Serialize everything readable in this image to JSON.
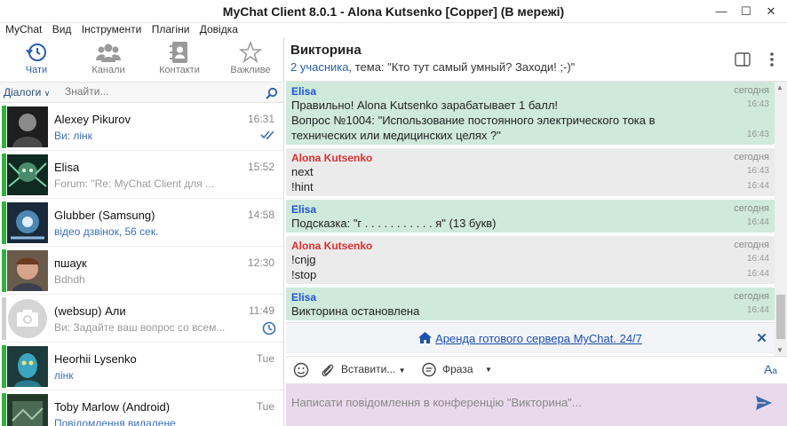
{
  "window": {
    "title": "MyChat Client 8.0.1 - Alona Kutsenko [Copper] (В мережі)"
  },
  "menu": [
    "MyChat",
    "Вид",
    "Інструменти",
    "Плагіни",
    "Довідка"
  ],
  "nav": [
    {
      "label": "Чати",
      "icon": "history-clock-icon",
      "active": true
    },
    {
      "label": "Канали",
      "icon": "group-icon",
      "active": false
    },
    {
      "label": "Контакти",
      "icon": "address-book-icon",
      "active": false
    },
    {
      "label": "Важливе",
      "icon": "star-icon",
      "active": false
    }
  ],
  "filter": {
    "dropdown": "Діалоги",
    "search_placeholder": "Знайти..."
  },
  "contacts": [
    {
      "name": "Alexey Pikurov",
      "sub": "Ви: лінк",
      "time": "16:31",
      "status": "online",
      "sub_style": "blue",
      "mark": "double-check-icon"
    },
    {
      "name": "Elisa",
      "sub": "Forum: \"Re: MyChat Client для ...",
      "time": "15:52",
      "status": "online",
      "sub_style": "gray",
      "mark": ""
    },
    {
      "name": "Glubber (Samsung)",
      "sub": "відео дзвінок, 56 сек.",
      "time": "14:58",
      "status": "online",
      "sub_style": "blue",
      "mark": ""
    },
    {
      "name": "пшаук",
      "sub": "Bdhdh",
      "time": "12:30",
      "status": "online",
      "sub_style": "gray",
      "mark": ""
    },
    {
      "name": "(websup) Али",
      "sub": "Ви: Задайте ваш вопрос со всем...",
      "time": "11:49",
      "status": "offline",
      "sub_style": "gray",
      "mark": "clock-icon"
    },
    {
      "name": "Heorhii Lysenko",
      "sub": "лінк",
      "time": "Tue",
      "status": "online",
      "sub_style": "blue",
      "mark": ""
    },
    {
      "name": "Toby Marlow (Android)",
      "sub": "Повідомлення видалене",
      "time": "Tue",
      "status": "online",
      "sub_style": "blue",
      "mark": ""
    }
  ],
  "chat": {
    "title": "Викторина",
    "participants": "2 учасника",
    "topic": ", тема: \"Кто тут самый умный? Заходи! ;-)\""
  },
  "messages": [
    {
      "author": "Elisa",
      "color": "blue",
      "bg": "green",
      "date": "сегодня",
      "lines": [
        {
          "text": "Правильно! Alona Kutsenko зарабатывает 1 балл!",
          "time": "16:43"
        },
        {
          "text": "Вопрос №1004: \"Использование постоянного электрического тока в технических или медицинских целях ?\"",
          "time": "16:43"
        }
      ]
    },
    {
      "author": "Alona Kutsenko",
      "color": "red",
      "bg": "gray",
      "date": "сегодня",
      "lines": [
        {
          "text": "next",
          "time": "16:43"
        },
        {
          "text": "!hint",
          "time": "16:44"
        }
      ]
    },
    {
      "author": "Elisa",
      "color": "blue",
      "bg": "green",
      "date": "сегодня",
      "lines": [
        {
          "text": "Подсказка: \"г . . . . . . . . . . . я\" (13 букв)",
          "time": "16:44"
        }
      ]
    },
    {
      "author": "Alona Kutsenko",
      "color": "red",
      "bg": "gray",
      "date": "сегодня",
      "lines": [
        {
          "text": "!cnjg",
          "time": "16:44"
        },
        {
          "text": "!stop",
          "time": "16:44"
        }
      ]
    },
    {
      "author": "Elisa",
      "color": "blue",
      "bg": "green",
      "date": "сегодня",
      "lines": [
        {
          "text": "Викторина остановлена",
          "time": "16:44"
        }
      ]
    }
  ],
  "banner": {
    "link": "Аренда готового сервера MyChat. 24/7"
  },
  "toolbar": {
    "insert": "Вставити...",
    "phrase": "Фраза"
  },
  "composer": {
    "placeholder": "Написати повідомлення в конференцію \"Викторина\"..."
  }
}
